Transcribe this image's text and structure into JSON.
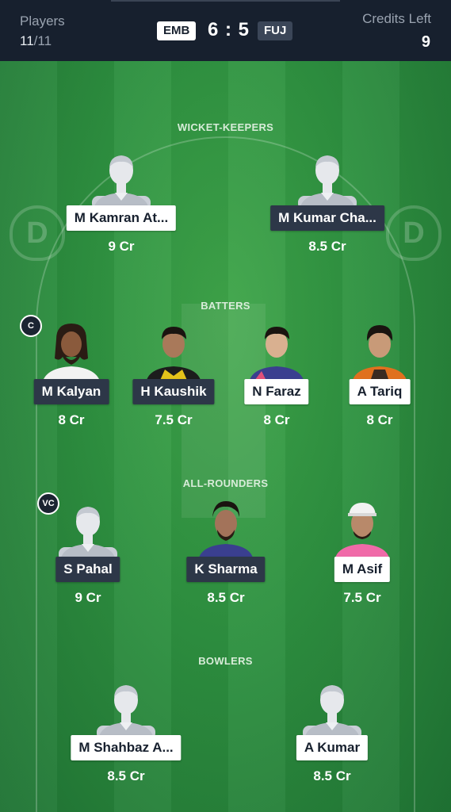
{
  "header": {
    "players_label": "Players",
    "players_selected": "11",
    "players_total": "/11",
    "team_left": "EMB",
    "score": "6 : 5",
    "team_right": "FUJ",
    "credits_label": "Credits Left",
    "credits_value": "9"
  },
  "sections": {
    "wicket_keepers": "WICKET-KEEPERS",
    "batters": "BATTERS",
    "all_rounders": "ALL-ROUNDERS",
    "bowlers": "BOWLERS"
  },
  "logo_letter": "D",
  "players": {
    "wk1": {
      "name": "M Kamran At...",
      "credits": "9 Cr",
      "team": "EMB",
      "avatar": "placeholder-avatar"
    },
    "wk2": {
      "name": "M Kumar Cha...",
      "credits": "8.5 Cr",
      "team": "FUJ",
      "avatar": "placeholder-avatar"
    },
    "bat1": {
      "name": "M Kalyan",
      "credits": "8 Cr",
      "team": "FUJ",
      "avatar": "player-photo",
      "role": "C"
    },
    "bat2": {
      "name": "H Kaushik",
      "credits": "7.5 Cr",
      "team": "FUJ",
      "avatar": "player-photo"
    },
    "bat3": {
      "name": "N Faraz",
      "credits": "8 Cr",
      "team": "EMB",
      "avatar": "player-photo"
    },
    "bat4": {
      "name": "A Tariq",
      "credits": "8 Cr",
      "team": "EMB",
      "avatar": "player-photo"
    },
    "ar1": {
      "name": "S Pahal",
      "credits": "9 Cr",
      "team": "FUJ",
      "avatar": "placeholder-avatar",
      "role": "VC"
    },
    "ar2": {
      "name": "K Sharma",
      "credits": "8.5 Cr",
      "team": "FUJ",
      "avatar": "player-photo"
    },
    "ar3": {
      "name": "M Asif",
      "credits": "7.5 Cr",
      "team": "EMB",
      "avatar": "player-photo"
    },
    "bowl1": {
      "name": "M Shahbaz A...",
      "credits": "8.5 Cr",
      "team": "EMB",
      "avatar": "placeholder-avatar"
    },
    "bowl2": {
      "name": "A Kumar",
      "credits": "8.5 Cr",
      "team": "EMB",
      "avatar": "placeholder-avatar"
    }
  },
  "colors": {
    "header_bg": "#17202e",
    "field_green": "#2e9140",
    "pill_light": "#ffffff",
    "pill_dark": "#2d3748"
  }
}
